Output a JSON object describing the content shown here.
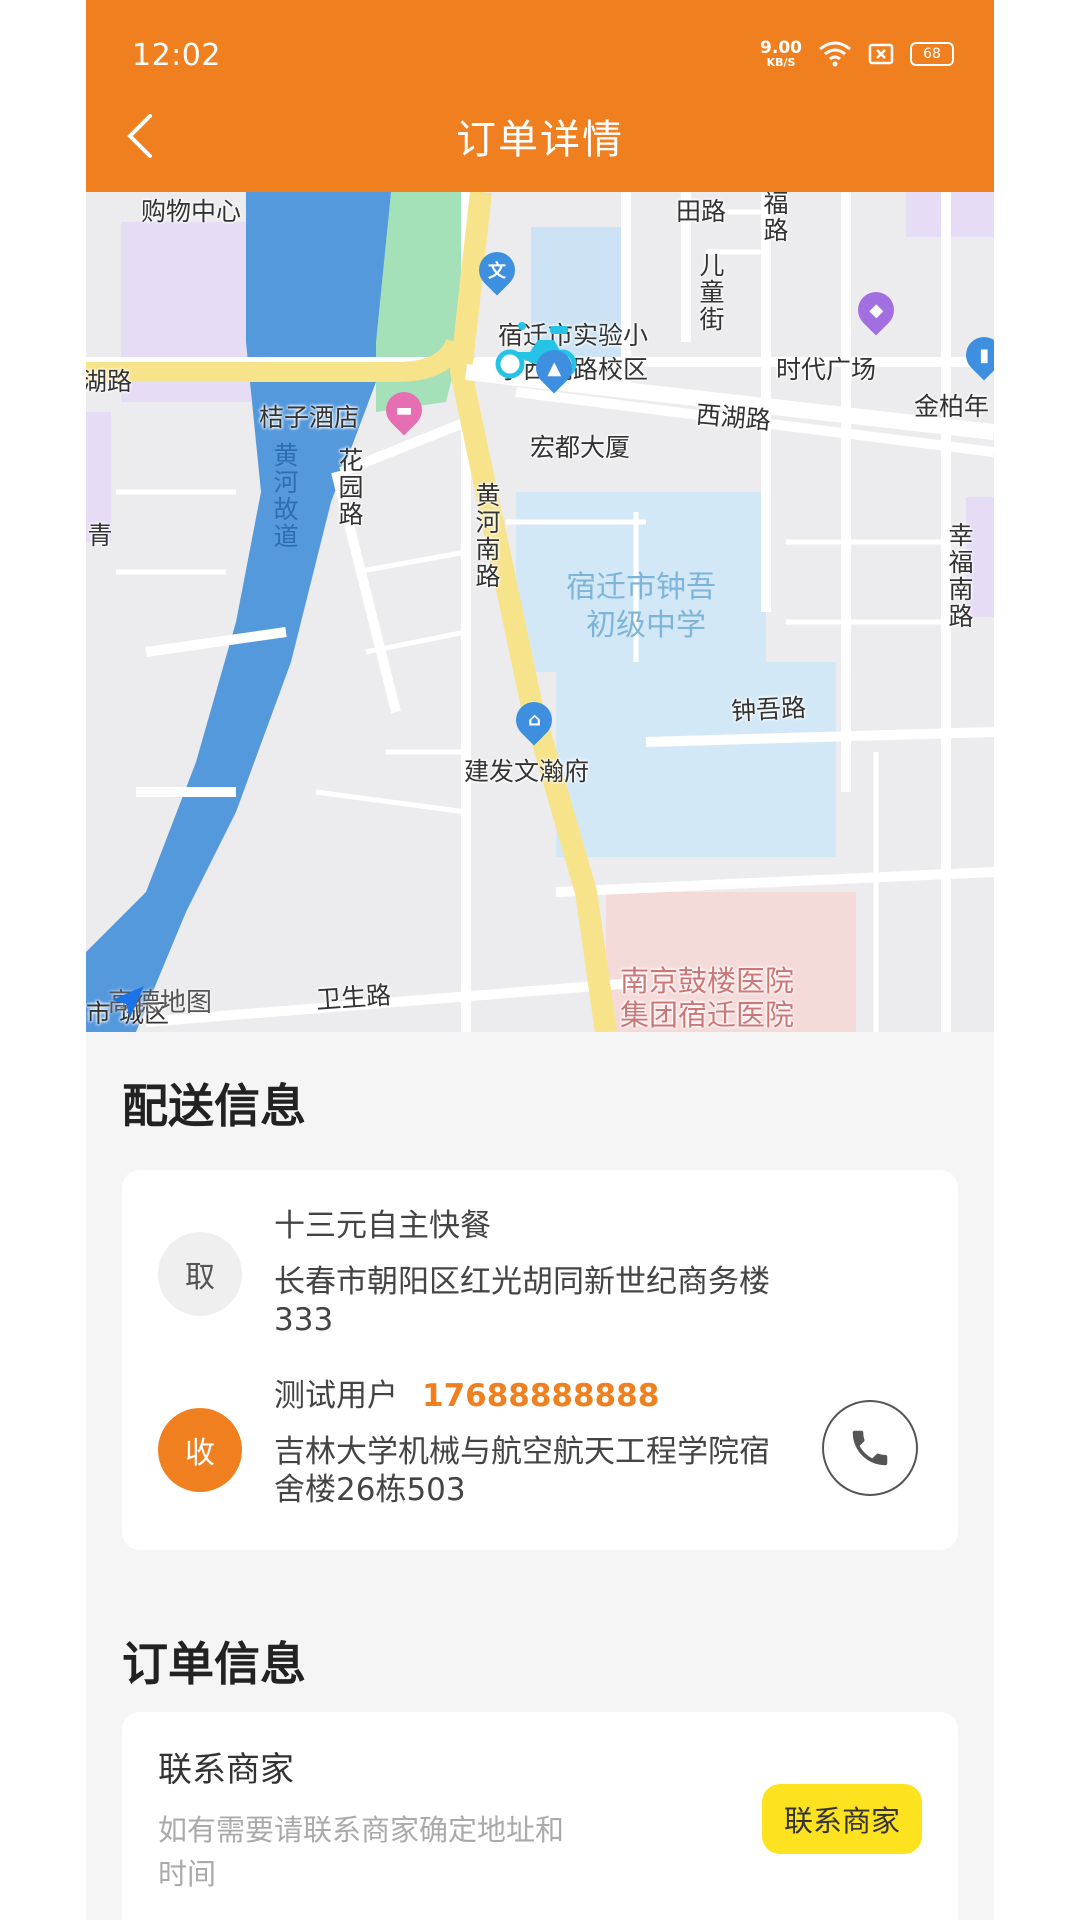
{
  "status_bar": {
    "time": "12:02",
    "net_speed_value": "9.00",
    "net_speed_unit": "KB/S",
    "battery": "68",
    "icons": [
      "wifi-icon",
      "sim-icon",
      "battery-icon"
    ]
  },
  "header": {
    "title": "订单详情",
    "back_icon": "chevron-left-icon",
    "color": "#f07f1f"
  },
  "map": {
    "labels": {
      "shopping_center": "购物中心",
      "school_west": "宿迁市实验小学西湖路校区",
      "school_line1": "宿迁市实验小",
      "school_line2": "学西湖路校区",
      "ertong": "儿童街",
      "times_square": "时代广场",
      "jinbai": "金柏年",
      "hu_road": "湖路",
      "juzi_hotel": "桔子酒店",
      "xihu_road": "西湖路",
      "hongdu": "宏都大厦",
      "huayuan_road": "花园路",
      "huanghe_gudao": "黄河故道",
      "huanghe_nanlu": "黄河南路",
      "zhongwu_school_1": "宿迁市钟吾",
      "zhongwu_school_2": "初级中学",
      "xingfu_nanlu": "幸福南路",
      "zhongwu_road": "钟吾路",
      "jianfa": "建发文瀚府",
      "hospital_1": "南京鼓楼医院",
      "hospital_2": "集团宿迁医院",
      "weisheng_road": "卫生路",
      "amap": "高德地图",
      "top_road_1": "田路",
      "top_road_2": "福路",
      "left_edge": "青",
      "bottom_left": "市  城区"
    }
  },
  "delivery": {
    "section_title": "配送信息",
    "pickup": {
      "badge": "取",
      "name": "十三元自主快餐",
      "address_line1": "长春市朝阳区红光胡同新世纪商务楼",
      "address_line2": "333"
    },
    "receiver": {
      "badge": "收",
      "name": "测试用户",
      "phone": "17688888888",
      "address_line1": "吉林大学机械与航空航天工程学院宿",
      "address_line2": "舍楼26栋503",
      "call_icon": "phone-icon"
    }
  },
  "order": {
    "section_title": "订单信息",
    "contact_title": "联系商家",
    "contact_desc_line1": "如有需要请联系商家确定地址和",
    "contact_desc_line2": "时间",
    "contact_button": "联系商家"
  }
}
